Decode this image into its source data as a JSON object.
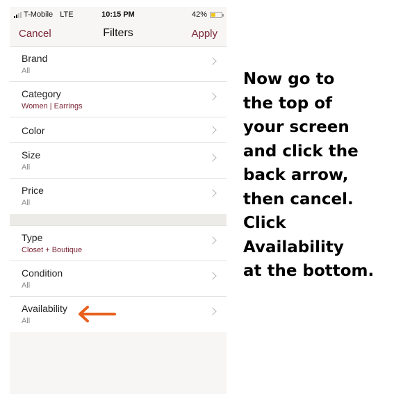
{
  "status_bar": {
    "carrier": "T-Mobile",
    "network": "LTE",
    "time": "10:15 PM",
    "battery": "42%",
    "battery_level": 0.42,
    "battery_color": "#f2c31c"
  },
  "nav": {
    "cancel": "Cancel",
    "title": "Filters",
    "apply": "Apply"
  },
  "colors": {
    "accent": "#7a2535",
    "annotation_arrow": "#e8601c"
  },
  "filters": [
    {
      "label": "Brand",
      "value": "All"
    },
    {
      "label": "Category",
      "value": "Women | Earrings"
    },
    {
      "label": "Color",
      "value": ""
    },
    {
      "label": "Size",
      "value": "All"
    },
    {
      "label": "Price",
      "value": "All"
    },
    {
      "label": "Type",
      "value": "Closet + Boutique"
    },
    {
      "label": "Condition",
      "value": "All"
    },
    {
      "label": "Availability",
      "value": "All"
    }
  ],
  "instruction": {
    "lines": [
      "Now go to",
      "the top of",
      "your screen",
      "and click the",
      "back arrow,",
      "then cancel.",
      "Click",
      "Availability",
      "at the bottom."
    ]
  }
}
